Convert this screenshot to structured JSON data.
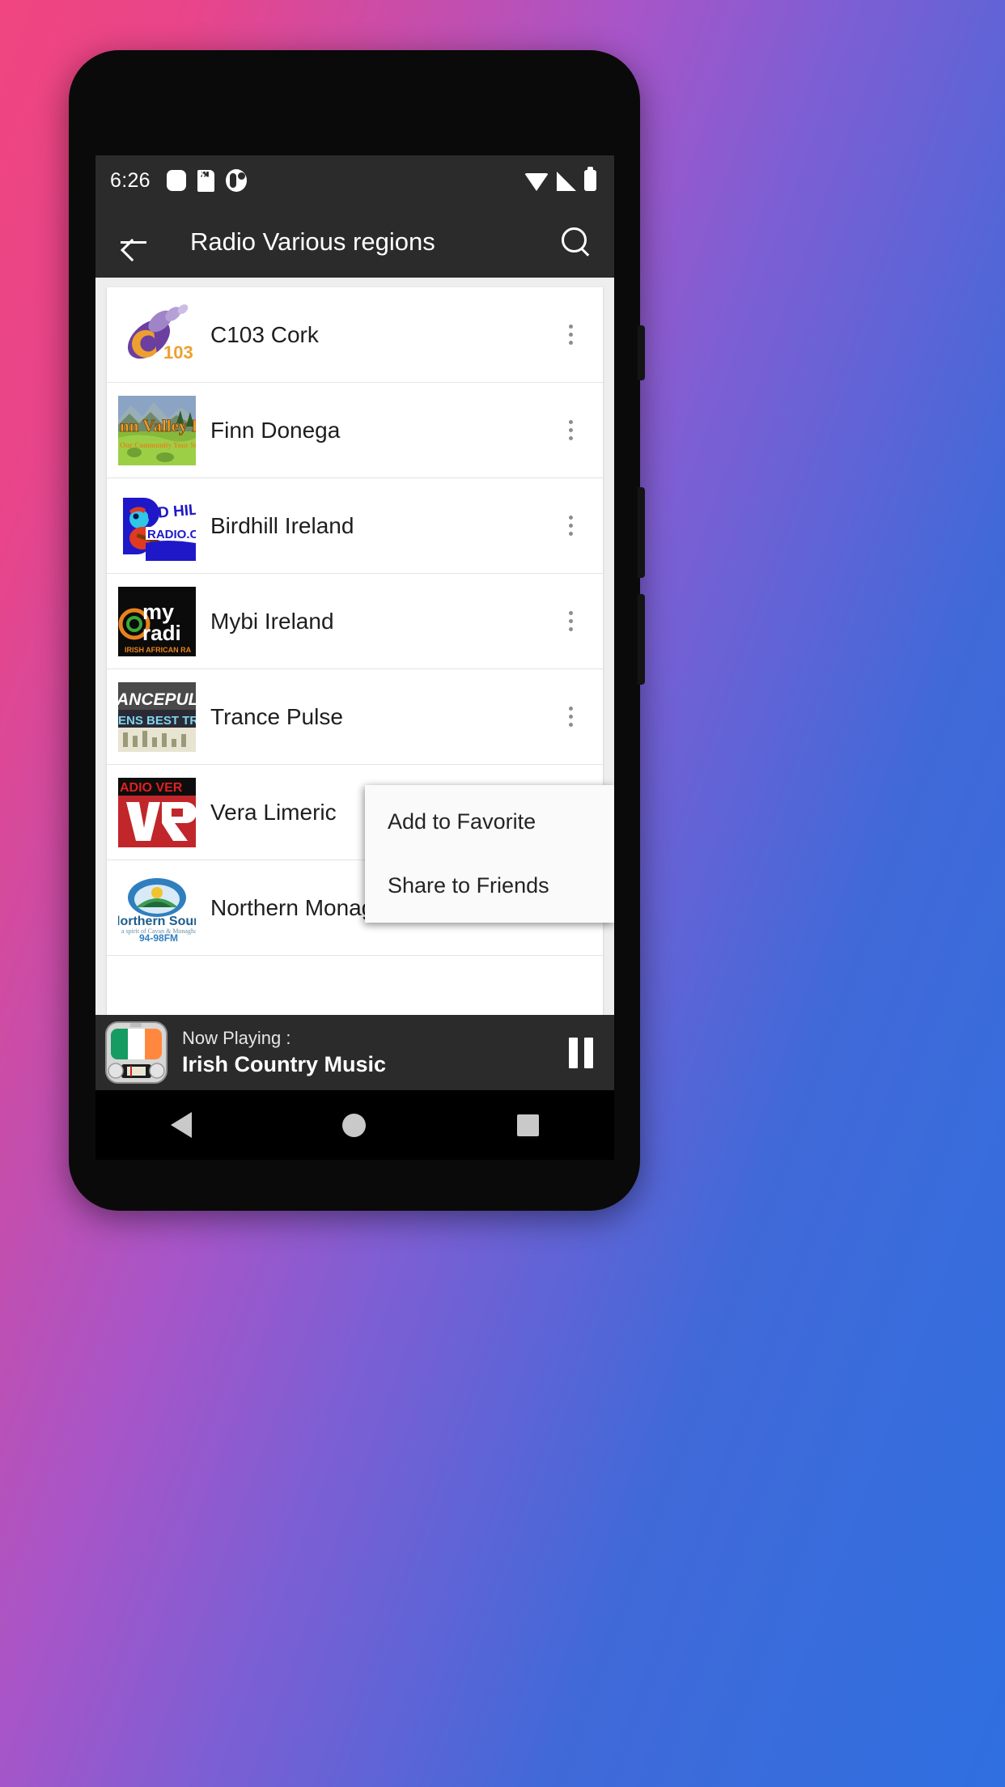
{
  "statusbar": {
    "time": "6:26",
    "left_icons": [
      "rounded-square-icon",
      "sdcard-icon",
      "app-badge-icon"
    ],
    "right_icons": [
      "wifi-icon",
      "cellular-signal-icon",
      "battery-icon"
    ]
  },
  "appbar": {
    "back_label": "back-arrow-icon",
    "title": "Radio Various regions",
    "search_label": "search-icon"
  },
  "stations": [
    {
      "name": "C103 Cork",
      "thumb": "c103-cork-logo"
    },
    {
      "name": "Finn Donega",
      "thumb": "finn-valley-radio-logo"
    },
    {
      "name": "Birdhill Ireland",
      "thumb": "birdhill-radio-logo"
    },
    {
      "name": "Mybi Ireland",
      "thumb": "mybi-radio-logo"
    },
    {
      "name": "Trance Pulse",
      "thumb": "trance-pulse-logo"
    },
    {
      "name": "Vera Limeric",
      "thumb": "radio-vera-logo"
    },
    {
      "name": "Northern Monagha",
      "thumb": "northern-sound-logo"
    }
  ],
  "popup": {
    "items": [
      {
        "label": "Add to Favorite"
      },
      {
        "label": "Share to Friends"
      }
    ]
  },
  "nowplaying": {
    "label": "Now Playing :",
    "title": "Irish Country Music",
    "art": "irish-flag-radio-icon",
    "button": "pause-icon"
  },
  "navbar": {
    "back": "nav-back-triangle",
    "home": "nav-home-circle",
    "recents": "nav-recents-square"
  },
  "colors": {
    "appbar_bg": "#2b2b2b",
    "content_bg": "#eeeeee",
    "card_bg": "#ffffff",
    "accent_purple": "#6b3fa0",
    "accent_orange": "#eda02f"
  }
}
